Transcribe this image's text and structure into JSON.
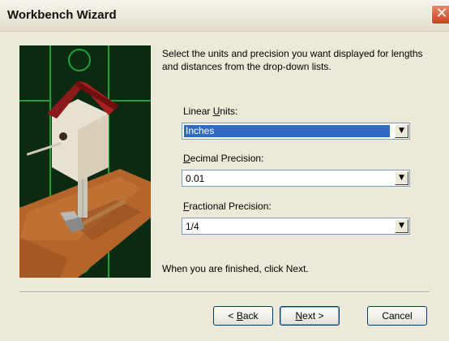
{
  "window": {
    "title": "Workbench Wizard",
    "close_glyph": "✕"
  },
  "description": "Select the units and precision you want displayed for lengths and distances from the drop-down lists.",
  "fields": {
    "linear_units": {
      "label_pre": "Linear ",
      "label_key": "U",
      "label_post": "nits:",
      "value": "Inches"
    },
    "decimal_precision": {
      "label_key": "D",
      "label_post": "ecimal Precision:",
      "value": "0.01"
    },
    "fractional_precision": {
      "label_key": "F",
      "label_post": "ractional Precision:",
      "value": "1/4"
    }
  },
  "dropdown_arrow": "▼",
  "instruction": "When you are finished, click Next.",
  "buttons": {
    "back": {
      "pre": "< ",
      "key": "B",
      "post": "ack"
    },
    "next": {
      "key": "N",
      "post": "ext >"
    },
    "cancel": "Cancel"
  },
  "colors": {
    "selection": "#316AC5",
    "dialog_bg": "#ECE9D8",
    "close_button": "#C8441E"
  }
}
